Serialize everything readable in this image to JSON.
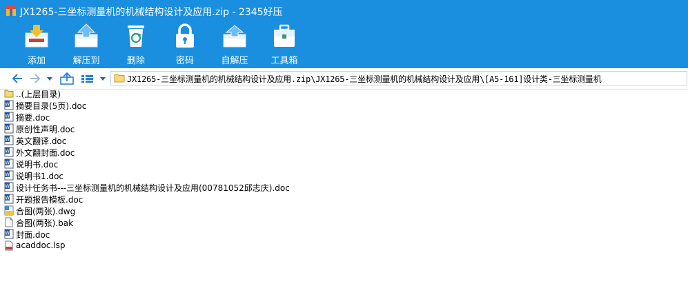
{
  "window": {
    "title": "JX1265-三坐标测量机的机械结构设计及应用.zip - 2345好压",
    "app_icon": "archive-app-icon"
  },
  "toolbar": {
    "buttons": [
      {
        "label": "添加",
        "icon": "add-archive-icon"
      },
      {
        "label": "解压到",
        "icon": "extract-to-icon"
      },
      {
        "label": "删除",
        "icon": "recycle-bin-icon"
      },
      {
        "label": "密码",
        "icon": "lock-icon"
      },
      {
        "label": "自解压",
        "icon": "self-extract-icon"
      },
      {
        "label": "工具箱",
        "icon": "toolbox-icon"
      }
    ]
  },
  "navigation": {
    "icons": [
      "back-arrow-icon",
      "forward-arrow-icon",
      "history-dropdown-icon",
      "up-folder-icon",
      "view-mode-icon",
      "view-dropdown-icon"
    ]
  },
  "address": {
    "path": "JX1265-三坐标测量机的机械结构设计及应用.zip\\JX1265-三坐标测量机的机械结构设计及应用\\[A5-161]设计类-三坐标测量机"
  },
  "files": [
    {
      "name": "..(上层目录)",
      "type": "parent-folder"
    },
    {
      "name": "摘要目录(5页).doc",
      "type": "doc"
    },
    {
      "name": "摘要.doc",
      "type": "doc"
    },
    {
      "name": "原创性声明.doc",
      "type": "doc"
    },
    {
      "name": "英文翻译.doc",
      "type": "doc"
    },
    {
      "name": "外文翻封面.doc",
      "type": "doc"
    },
    {
      "name": "说明书.doc",
      "type": "doc"
    },
    {
      "name": "说明书1.doc",
      "type": "doc"
    },
    {
      "name": "设计任务书---三坐标测量机的机械结构设计及应用(00781052邱志庆).doc",
      "type": "doc"
    },
    {
      "name": "开题报告模板.doc",
      "type": "doc"
    },
    {
      "name": "合图(两张).dwg",
      "type": "dwg"
    },
    {
      "name": "合图(两张).bak",
      "type": "bak"
    },
    {
      "name": "封面.doc",
      "type": "doc"
    },
    {
      "name": "acaddoc.lsp",
      "type": "lsp"
    }
  ],
  "colors": {
    "toolbar_bg": "#1a8fe0",
    "toolbar_text": "#ffffff",
    "nav_arrow": "#2a7fd4"
  }
}
